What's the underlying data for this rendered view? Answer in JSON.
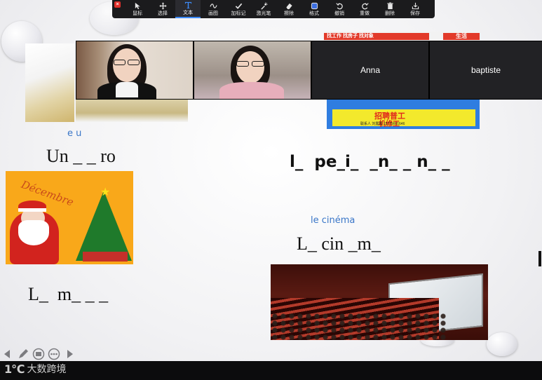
{
  "toolbar": {
    "close_glyph": "×",
    "tools": [
      {
        "id": "mouse",
        "label": "鼠标",
        "icon": "cursor-icon"
      },
      {
        "id": "select",
        "label": "选择",
        "icon": "move-icon"
      },
      {
        "id": "text",
        "label": "文本",
        "icon": "text-icon",
        "active": true
      },
      {
        "id": "draw",
        "label": "画图",
        "icon": "squiggle-icon"
      },
      {
        "id": "stamp",
        "label": "加标记",
        "icon": "checkmark-icon"
      },
      {
        "id": "spotlight",
        "label": "激光笔",
        "icon": "laser-pen-icon"
      },
      {
        "id": "eraser",
        "label": "擦除",
        "icon": "eraser-icon"
      },
      {
        "id": "format",
        "label": "格式",
        "icon": "format-square-icon"
      },
      {
        "id": "undo",
        "label": "撤销",
        "icon": "undo-icon"
      },
      {
        "id": "redo",
        "label": "重做",
        "icon": "redo-icon"
      },
      {
        "id": "clear",
        "label": "删除",
        "icon": "trash-icon"
      },
      {
        "id": "save",
        "label": "保存",
        "icon": "save-icon"
      }
    ]
  },
  "participants": [
    {
      "type": "video"
    },
    {
      "type": "video"
    },
    {
      "type": "name",
      "name": "Anna"
    },
    {
      "type": "name",
      "name": "baptiste"
    }
  ],
  "slide": {
    "hint_eu": "e u",
    "word_1": "Un _ _ ro",
    "word_2": "l_  pe_i_  _n_ _ n_ _",
    "hint_cinema": "le cinéma",
    "word_3": "L_ cin _m_",
    "word_4": "L_  m_ _ _",
    "xmas_caption": "Décembre",
    "ad_top_left": "找工作  找房子  找对象",
    "ad_top_right": "生活",
    "ad_bottom_line1": "招聘普工",
    "ad_bottom_line2": "机修工",
    "ad_bottom_small": "联系人   刘露霞   13775601646"
  },
  "footer": {
    "logo_mark": "1℃",
    "logo_name": "大数跨境"
  }
}
